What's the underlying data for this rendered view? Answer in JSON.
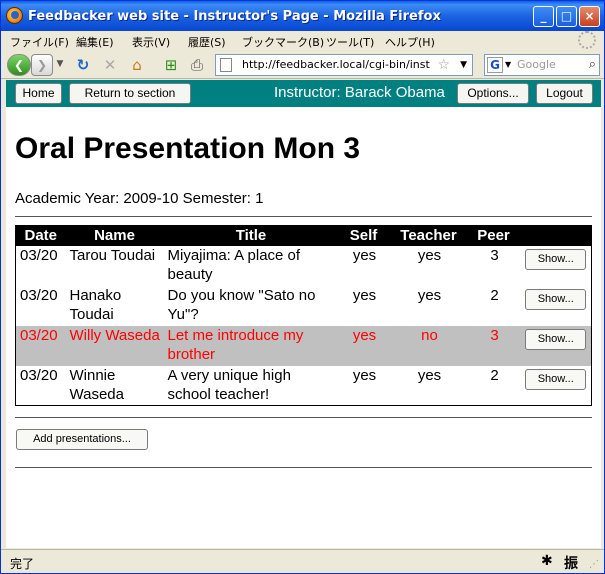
{
  "window": {
    "title": "Feedbacker web site - Instructor's Page - Mozilla Firefox",
    "minimize": "_",
    "maximize": "□",
    "close": "×"
  },
  "menu": [
    "ファイル(F)",
    "編集(E)",
    "表示(V)",
    "履歴(S)",
    "ブックマーク(B)",
    "ツール(T)",
    "ヘルプ(H)"
  ],
  "nav": {
    "url": "http://feedbacker.local/cgi-bin/inst",
    "search_placeholder": "Google"
  },
  "appbar": {
    "home": "Home",
    "return": "Return to section",
    "instructor": "Instructor: Barack Obama",
    "options": "Options...",
    "logout": "Logout"
  },
  "page": {
    "title": "Oral Presentation Mon 3",
    "year_line": "Academic Year: 2009-10 Semester: 1"
  },
  "table": {
    "headers": [
      "Date",
      "Name",
      "Title",
      "Self",
      "Teacher",
      "Peer",
      ""
    ],
    "show_label": "Show...",
    "rows": [
      {
        "date": "03/20",
        "name": "Tarou Toudai",
        "title": "Miyajima: A place of beauty",
        "self": "yes",
        "teacher": "yes",
        "peer": "3",
        "highlight": false
      },
      {
        "date": "03/20",
        "name": "Hanako Toudai",
        "title": "Do you know \"Sato no Yu\"?",
        "self": "yes",
        "teacher": "yes",
        "peer": "2",
        "highlight": false
      },
      {
        "date": "03/20",
        "name": "Willy Waseda",
        "title": "Let me introduce my brother",
        "self": "yes",
        "teacher": "no",
        "peer": "3",
        "highlight": true
      },
      {
        "date": "03/20",
        "name": "Winnie Waseda",
        "title": "A very unique high school teacher!",
        "self": "yes",
        "teacher": "yes",
        "peer": "2",
        "highlight": false
      }
    ]
  },
  "add_button": "Add presentations...",
  "status": {
    "text": "完了",
    "badge": "振"
  },
  "colors": {
    "appbar": "#008080",
    "highlight_bg": "#c0c0c0",
    "highlight_text": "#ff0000"
  }
}
